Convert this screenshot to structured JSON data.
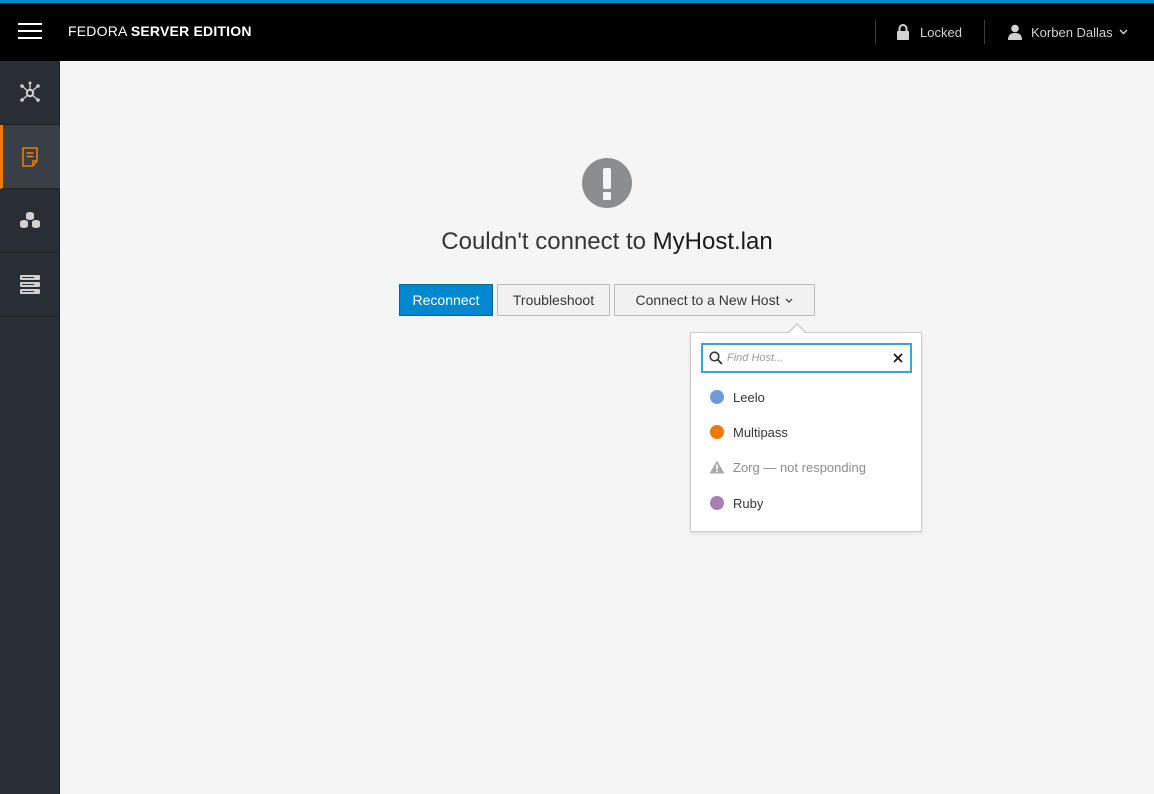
{
  "header": {
    "brand_light": "FEDORA ",
    "brand_bold": "SERVER EDITION",
    "lock_label": "Locked",
    "user_name": "Korben Dallas",
    "accent_color": "#0088ce"
  },
  "sidebar": {
    "items": [
      {
        "icon": "network-icon",
        "active": false
      },
      {
        "icon": "document-icon",
        "active": true
      },
      {
        "icon": "containers-icon",
        "active": false
      },
      {
        "icon": "server-rack-icon",
        "active": false
      }
    ],
    "active_color": "#ec7a08"
  },
  "main": {
    "headline_prefix": "Couldn't connect to ",
    "host": "MyHost.lan",
    "buttons": {
      "reconnect": "Reconnect",
      "troubleshoot": "Troubleshoot",
      "connect_new": "Connect to a New Host"
    }
  },
  "popover": {
    "search_placeholder": "Find Host...",
    "search_value": "",
    "hosts": [
      {
        "name": "Leelo",
        "color": "#6d9bd3",
        "status": "ok"
      },
      {
        "name": "Multipass",
        "color": "#ec7a08",
        "status": "ok"
      },
      {
        "name": "Zorg — not responding",
        "color": "#aaaaaa",
        "status": "warning"
      },
      {
        "name": "Ruby",
        "color": "#a77fb5",
        "status": "ok"
      }
    ]
  }
}
